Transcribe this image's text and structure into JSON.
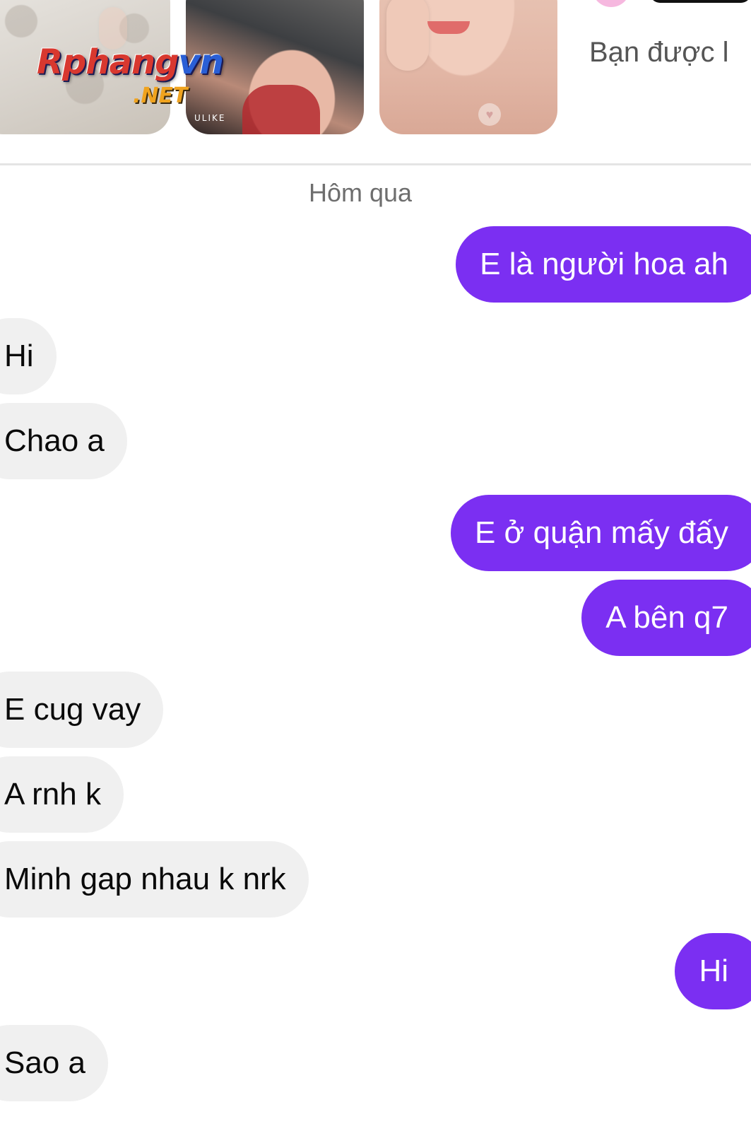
{
  "header": {
    "profile_subtitle": "Bạn được l",
    "watermark": {
      "main": "Rphangvn",
      "sub": ".NET"
    },
    "photo_2_label": "ULIKE"
  },
  "thread": {
    "date_separator": "Hôm qua",
    "messages": [
      {
        "from": "me",
        "text": "E là người hoa ah"
      },
      {
        "from": "them",
        "text": "Hi"
      },
      {
        "from": "them",
        "text": "Chao a"
      },
      {
        "from": "me",
        "text": "E ở quận mấy đấy"
      },
      {
        "from": "me",
        "text": "A bên q7"
      },
      {
        "from": "them",
        "text": "E cug vay"
      },
      {
        "from": "them",
        "text": "A rnh k"
      },
      {
        "from": "them",
        "text": "Minh gap nhau k nrk"
      },
      {
        "from": "me",
        "text": "Hi"
      },
      {
        "from": "them",
        "text": "Sao a"
      }
    ]
  },
  "colors": {
    "sent_bubble": "#7b2ff2",
    "received_bubble": "#f0f0f0",
    "background": "#ffffff"
  }
}
